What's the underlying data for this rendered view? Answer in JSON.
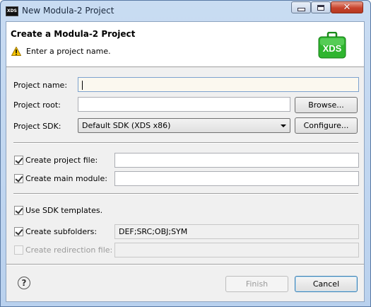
{
  "window": {
    "title": "New Modula-2 Project",
    "app_icon_text": "XDS"
  },
  "header": {
    "title": "Create a Modula-2 Project",
    "message": "Enter a project name.",
    "logo_text": "XDS"
  },
  "form": {
    "project_name": {
      "label": "Project name:",
      "value": ""
    },
    "project_root": {
      "label": "Project root:",
      "value": "",
      "browse_label": "Browse..."
    },
    "project_sdk": {
      "label": "Project SDK:",
      "selected": "Default SDK (XDS x86)",
      "configure_label": "Configure..."
    },
    "project_file": {
      "label": "Create project file:",
      "checked": true,
      "value": ""
    },
    "main_module": {
      "label": "Create main module:",
      "checked": true,
      "value": ""
    },
    "sdk_templates": {
      "label": "Use SDK templates.",
      "checked": true
    },
    "subfolders": {
      "label": "Create subfolders:",
      "checked": true,
      "value": "DEF;SRC;OBJ;SYM"
    },
    "redirection_file": {
      "label": "Create redirection file:",
      "checked": false,
      "disabled": true,
      "value": ""
    }
  },
  "footer": {
    "finish_label": "Finish",
    "cancel_label": "Cancel"
  },
  "icons": {
    "warning": "warning-icon",
    "help": "help-icon",
    "logo": "xds-logo-icon"
  }
}
